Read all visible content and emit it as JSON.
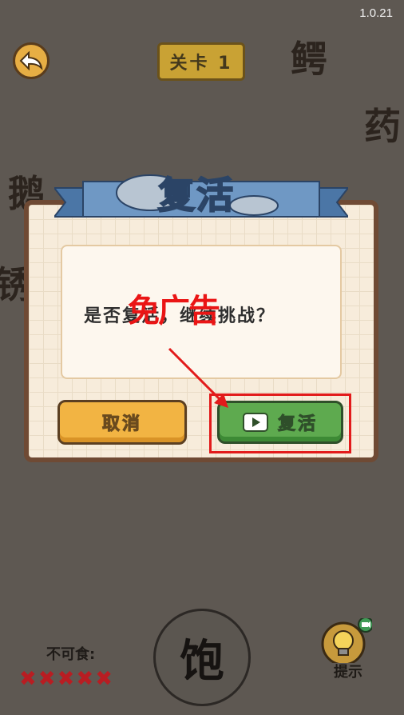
{
  "version": "1.0.21",
  "header": {
    "level_label": "关卡 1"
  },
  "background_chars": [
    "鳄",
    "药",
    "鹅",
    "锈"
  ],
  "dialog": {
    "title": "复活",
    "message": "是否复活，继续挑战？",
    "overlay_annotation": "免广告",
    "cancel_label": "取消",
    "revive_label": "复活",
    "revive_icon": "video-play-icon"
  },
  "bottom": {
    "forbidden_label": "不可食:",
    "strikes": [
      "✖",
      "✖",
      "✖",
      "✖",
      "✖"
    ],
    "current_char": "饱",
    "hint_label": "提示",
    "hint_icon": "lightbulb-icon"
  },
  "colors": {
    "background": "#5e5852",
    "annotation_red": "#e21b1b",
    "revive_green": "#5eaa4f",
    "cancel_orange": "#f2b443"
  }
}
